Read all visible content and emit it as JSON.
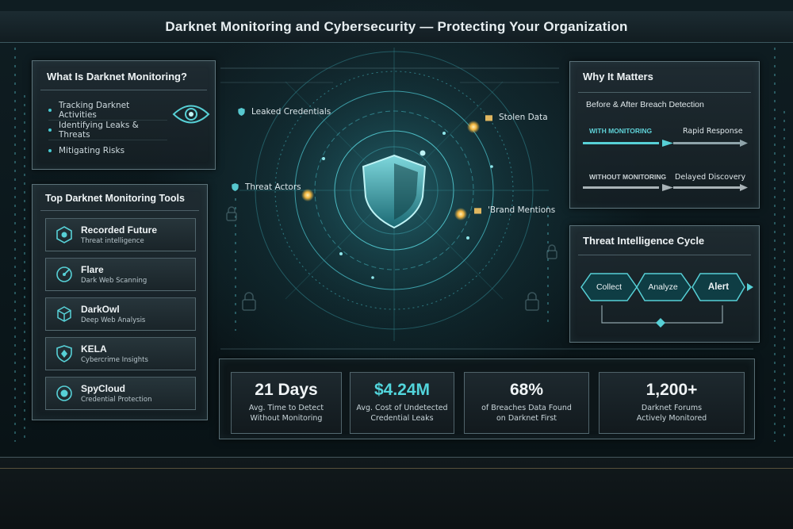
{
  "title": "Darknet Monitoring and Cybersecurity — Protecting Your Organization",
  "what_is": {
    "title": "What Is Darknet Monitoring?",
    "items": [
      "Tracking Darknet Activities",
      "Identifying Leaks & Threats",
      "Mitigating Risks"
    ]
  },
  "tools": {
    "title": "Top Darknet Monitoring Tools",
    "items": [
      {
        "name": "Recorded Future",
        "desc": "Threat intelligence"
      },
      {
        "name": "Flare",
        "desc": "Dark Web Scanning"
      },
      {
        "name": "DarkOwl",
        "desc": "Deep Web Analysis"
      },
      {
        "name": "KELA",
        "desc": "Cybercrime Insights"
      },
      {
        "name": "SpyCloud",
        "desc": "Credential Protection"
      }
    ]
  },
  "radar_labels": {
    "leaked": "Leaked Credentials",
    "stolen": "Stolen Data",
    "threat": "Threat Actors",
    "brand": "'Brand Mentions"
  },
  "why": {
    "title": "Why It Matters",
    "subtitle": "Before & After Breach Detection",
    "with_label": "WITH MONITORING",
    "with_result": "Rapid Response",
    "without_label": "WITHOUT MONITORING",
    "without_result": "Delayed Discovery"
  },
  "cycle": {
    "title": "Threat Intelligence Cycle",
    "steps": [
      "Collect",
      "Analyze",
      "Alert"
    ]
  },
  "stats": [
    {
      "value": "21 Days",
      "line1": "Avg. Time to Detect",
      "line2": "Without Monitoring"
    },
    {
      "value": "$4.24M",
      "line1": "Avg. Cost of Undetected",
      "line2": "Credential Leaks"
    },
    {
      "value": "68%",
      "line1": "of Breaches Data Found",
      "line2": "on Darknet First"
    },
    {
      "value": "1,200+",
      "line1": "Darknet Forums",
      "line2": "Actively Monitored"
    }
  ],
  "colors": {
    "accent": "#47c9d1",
    "gold": "#f2b640",
    "with": "#57d0d6",
    "without": "#a9b3b7"
  }
}
